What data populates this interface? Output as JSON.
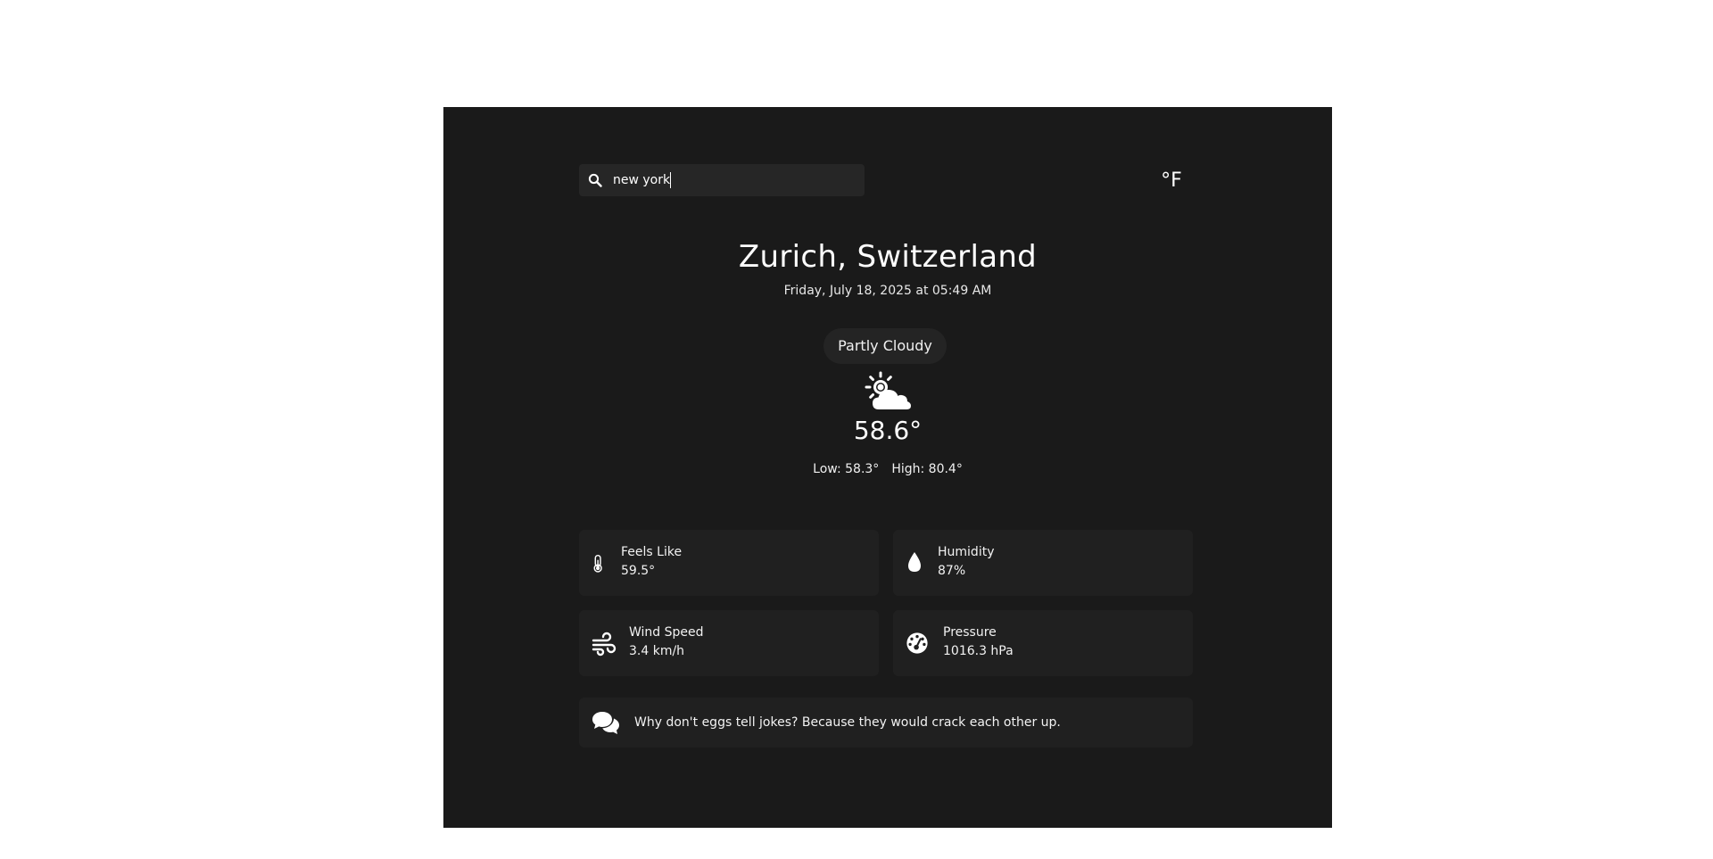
{
  "search": {
    "value": "new york",
    "icon": "search-icon"
  },
  "unit_toggle": {
    "label": "°F"
  },
  "location": {
    "name": "Zurich, Switzerland",
    "datetime": "Friday, July 18, 2025 at 05:49 AM"
  },
  "current": {
    "condition": "Partly Cloudy",
    "icon": "partly-cloudy-icon",
    "temperature": "58.6°",
    "low": "Low: 58.3°",
    "high": "High: 80.4°"
  },
  "details": [
    {
      "label": "Feels Like",
      "value": "59.5°",
      "icon": "thermometer-icon"
    },
    {
      "label": "Humidity",
      "value": "87%",
      "icon": "droplet-icon"
    },
    {
      "label": "Wind Speed",
      "value": "3.4 km/h",
      "icon": "wind-icon"
    },
    {
      "label": "Pressure",
      "value": "1016.3 hPa",
      "icon": "gauge-icon"
    }
  ],
  "joke": {
    "text": "Why don't eggs tell jokes? Because they would crack each other up.",
    "icon": "comments-icon"
  },
  "colors": {
    "panel_background": "#1a1a1a",
    "card_background": "#202020",
    "text": "#ffffff"
  }
}
